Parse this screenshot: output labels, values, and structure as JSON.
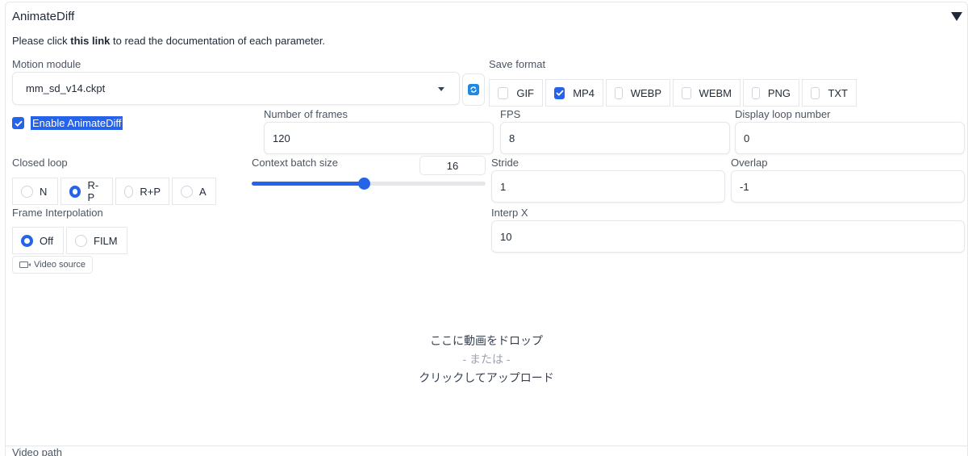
{
  "panel": {
    "title": "AnimateDiff",
    "doc_prefix": "Please click ",
    "doc_link": "this link",
    "doc_suffix": " to read the documentation of each parameter."
  },
  "motion_module": {
    "label": "Motion module",
    "value": "mm_sd_v14.ckpt"
  },
  "save_format": {
    "label": "Save format",
    "options": [
      {
        "label": "GIF",
        "checked": false
      },
      {
        "label": "MP4",
        "checked": true
      },
      {
        "label": "WEBP",
        "checked": false
      },
      {
        "label": "WEBM",
        "checked": false
      },
      {
        "label": "PNG",
        "checked": false
      },
      {
        "label": "TXT",
        "checked": false
      }
    ]
  },
  "enable": {
    "label": "Enable AnimateDiff",
    "checked": true
  },
  "number_of_frames": {
    "label": "Number of frames",
    "value": "120"
  },
  "fps": {
    "label": "FPS",
    "value": "8"
  },
  "display_loop": {
    "label": "Display loop number",
    "value": "0"
  },
  "closed_loop": {
    "label": "Closed loop",
    "options": [
      {
        "label": "N",
        "selected": false
      },
      {
        "label": "R-P",
        "selected": true
      },
      {
        "label": "R+P",
        "selected": false
      },
      {
        "label": "A",
        "selected": false
      }
    ]
  },
  "context_batch": {
    "label": "Context batch size",
    "value": "16",
    "fraction": 0.48
  },
  "stride": {
    "label": "Stride",
    "value": "1"
  },
  "overlap": {
    "label": "Overlap",
    "value": "-1"
  },
  "frame_interp": {
    "label": "Frame Interpolation",
    "options": [
      {
        "label": "Off",
        "selected": true
      },
      {
        "label": "FILM",
        "selected": false
      }
    ]
  },
  "interp_x": {
    "label": "Interp X",
    "value": "10"
  },
  "video_source": {
    "tag": "Video source",
    "drop_text": "ここに動画をドロップ",
    "or_text": "- または -",
    "click_text": "クリックしてアップロード"
  },
  "video_path": {
    "label": "Video path"
  },
  "colors": {
    "accent": "#2563eb",
    "refresh": "#1e88e5"
  }
}
